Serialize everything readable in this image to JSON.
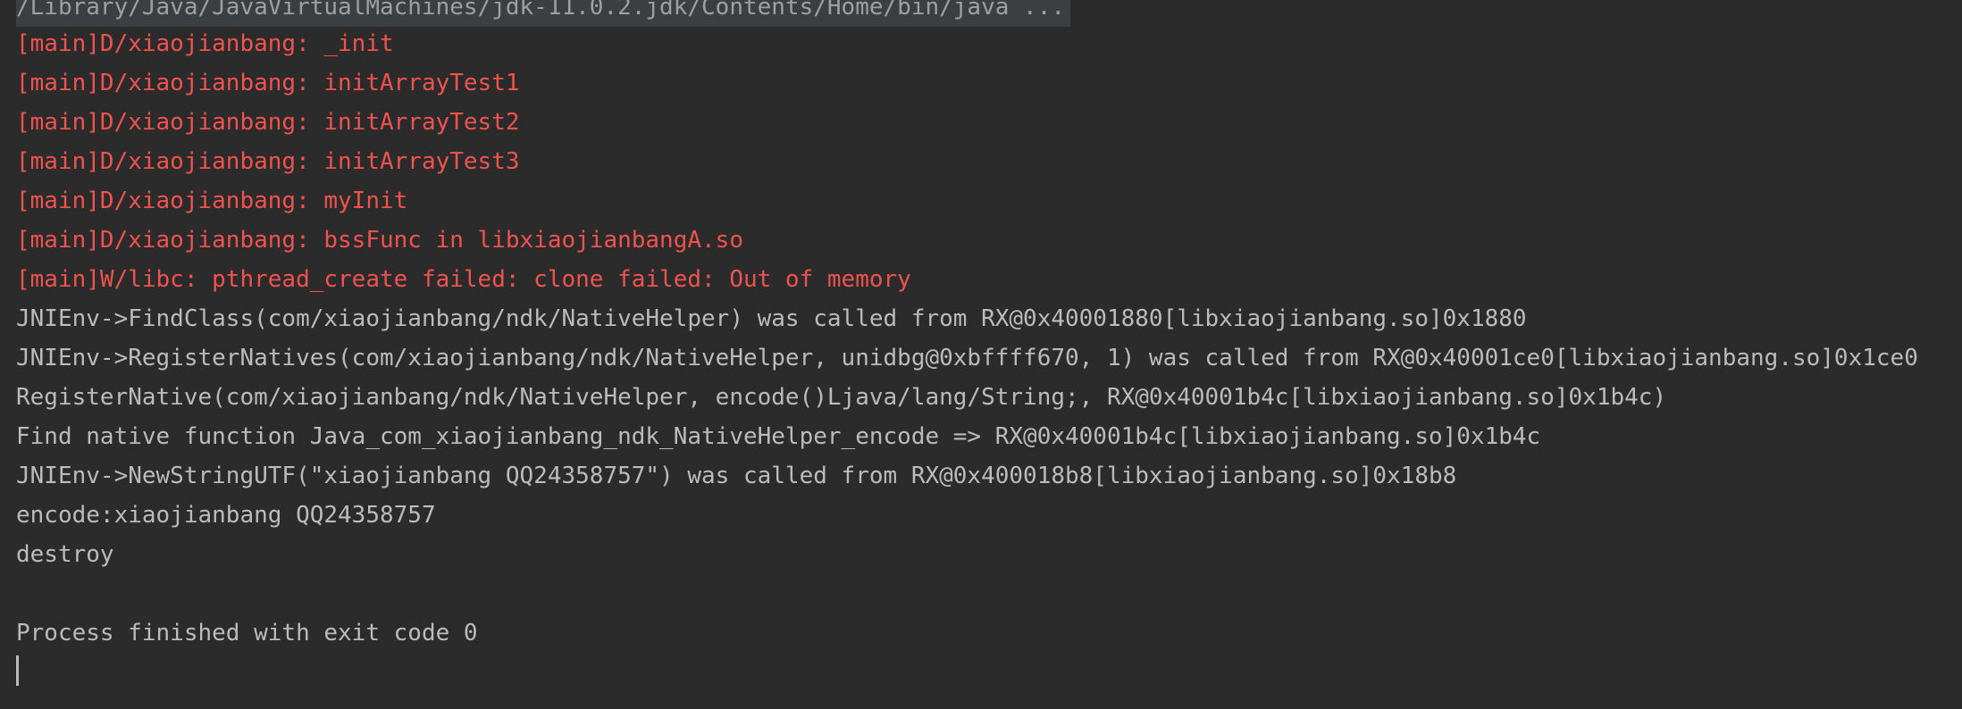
{
  "console": {
    "command": "/Library/Java/JavaVirtualMachines/jdk-11.0.2.jdk/Contents/Home/bin/java ...",
    "lines": [
      "[main]D/xiaojianbang: _init",
      "[main]D/xiaojianbang: initArrayTest1",
      "[main]D/xiaojianbang: initArrayTest2",
      "[main]D/xiaojianbang: initArrayTest3",
      "[main]D/xiaojianbang: myInit",
      "[main]D/xiaojianbang: bssFunc in libxiaojianbangA.so",
      "[main]W/libc: pthread_create failed: clone failed: Out of memory",
      "JNIEnv->FindClass(com/xiaojianbang/ndk/NativeHelper) was called from RX@0x40001880[libxiaojianbang.so]0x1880",
      "JNIEnv->RegisterNatives(com/xiaojianbang/ndk/NativeHelper, unidbg@0xbffff670, 1) was called from RX@0x40001ce0[libxiaojianbang.so]0x1ce0",
      "RegisterNative(com/xiaojianbang/ndk/NativeHelper, encode()Ljava/lang/String;, RX@0x40001b4c[libxiaojianbang.so]0x1b4c)",
      "Find native function Java_com_xiaojianbang_ndk_NativeHelper_encode => RX@0x40001b4c[libxiaojianbang.so]0x1b4c",
      "JNIEnv->NewStringUTF(\"xiaojianbang QQ24358757\") was called from RX@0x400018b8[libxiaojianbang.so]0x18b8",
      "encode:xiaojianbang QQ24358757",
      "destroy"
    ],
    "exit_message": "Process finished with exit code 0"
  },
  "colors": {
    "background": "#2b2b2b",
    "log_text": "#f0524f",
    "normal_text": "#bbbbbb",
    "command_highlight": "#3c3f41"
  }
}
